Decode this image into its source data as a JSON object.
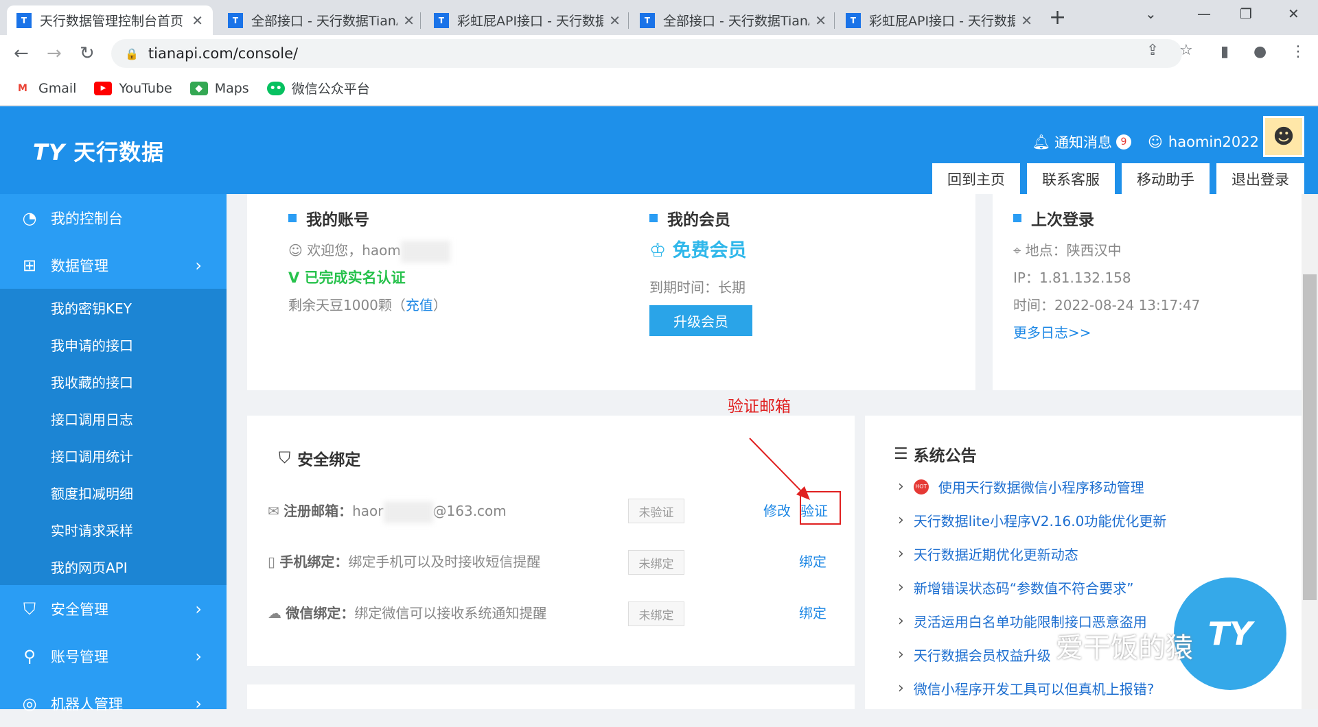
{
  "browser": {
    "tabs": [
      {
        "title": "天行数据管理控制台首页",
        "active": true
      },
      {
        "title": "全部接口 - 天行数据TianAPI"
      },
      {
        "title": "彩虹屁API接口 - 天行数据"
      },
      {
        "title": "全部接口 - 天行数据TianAPI"
      },
      {
        "title": "彩虹屁API接口 - 天行数据"
      }
    ],
    "url": "tianapi.com/console/",
    "bookmarks": [
      "Gmail",
      "YouTube",
      "Maps",
      "微信公众平台"
    ]
  },
  "header": {
    "logo": "天行数据",
    "notifications_label": "通知消息",
    "notifications_count": "9",
    "username": "haomin2022",
    "buttons": [
      "回到主页",
      "联系客服",
      "移动助手",
      "退出登录"
    ]
  },
  "sidebar": {
    "items": [
      {
        "label": "我的控制台",
        "icon": "dashboard-icon"
      },
      {
        "label": "数据管理",
        "icon": "cart-icon"
      },
      {
        "label": "安全管理",
        "icon": "shield-icon"
      },
      {
        "label": "账号管理",
        "icon": "user-icon"
      },
      {
        "label": "机器人管理",
        "icon": "robot-icon"
      }
    ],
    "sub_items": [
      "我的密钥KEY",
      "我申请的接口",
      "我收藏的接口",
      "接口调用日志",
      "接口调用统计",
      "额度扣减明细",
      "实时请求采样",
      "我的网页API"
    ]
  },
  "account": {
    "title": "我的账号",
    "welcome": "欢迎您，haom",
    "verified": "已完成实名认证",
    "beans_prefix": "剩余天豆1000颗（",
    "beans_link": "充值",
    "beans_suffix": "）"
  },
  "membership": {
    "title": "我的会员",
    "level": "免费会员",
    "expiry": "到期时间：长期",
    "upgrade": "升级会员"
  },
  "last_login": {
    "title": "上次登录",
    "location": "地点：陕西汉中",
    "ip": "IP：1.81.132.158",
    "time": "时间：2022-08-24 13:17:47",
    "more": "更多日志>>"
  },
  "annotation": "验证邮箱",
  "security": {
    "title": "安全绑定",
    "rows": [
      {
        "label": "注册邮箱：",
        "value_prefix": "haor",
        "value_suffix": "@163.com",
        "status": "未验证",
        "actions": [
          "修改",
          "验证"
        ]
      },
      {
        "label": "手机绑定：",
        "value": "绑定手机可以及时接收短信提醒",
        "status": "未绑定",
        "actions": [
          "绑定"
        ]
      },
      {
        "label": "微信绑定：",
        "value": "绑定微信可以接收系统通知提醒",
        "status": "未绑定",
        "actions": [
          "绑定"
        ]
      }
    ]
  },
  "notices": {
    "title": "系统公告",
    "items": [
      "使用天行数据微信小程序移动管理",
      "天行数据lite小程序V2.16.0功能优化更新",
      "天行数据近期优化更新动态",
      "新增错误状态码“参数值不符合要求”",
      "灵活运用白名单功能限制接口恶意盗用",
      "天行数据会员权益升级",
      "微信小程序开发工具可以但真机上报错?"
    ]
  },
  "watermark": "爱干饭的猿"
}
